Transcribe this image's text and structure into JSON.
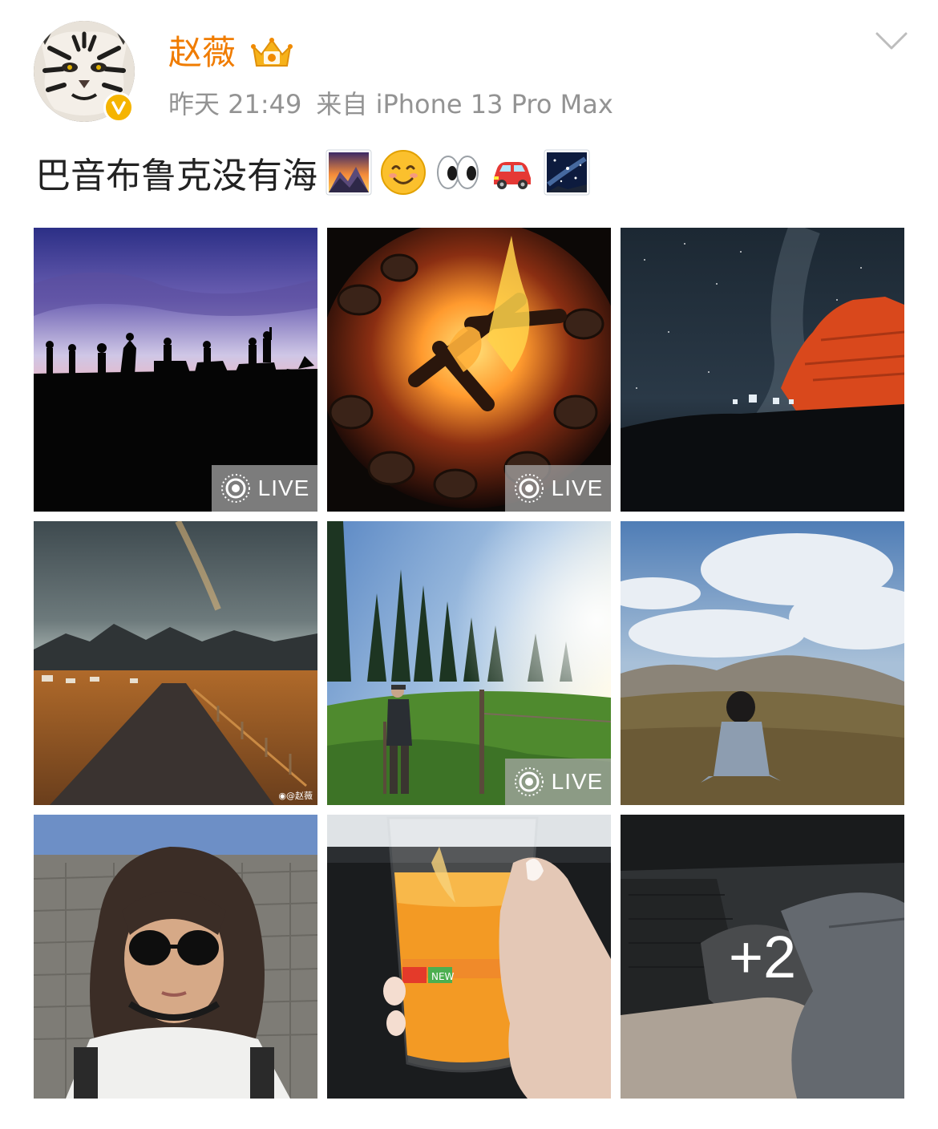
{
  "post": {
    "author": {
      "name": "赵薇",
      "avatar_icon": "tiger-face-avatar",
      "verified_icon": "verified-v-icon",
      "member_icon": "crown-icon"
    },
    "time": "昨天 21:49",
    "source": "来自 iPhone 13 Pro Max",
    "text": "巴音布鲁克没有海",
    "emojis": [
      "sunrise-over-mountains-emoji",
      "smiling-face-emoji",
      "eyes-emoji",
      "red-car-emoji",
      "milky-way-emoji"
    ],
    "menu_icon": "chevron-down-icon"
  },
  "photos": [
    {
      "id": "horse-riders-silhouette",
      "live": true,
      "live_label": "LIVE"
    },
    {
      "id": "campfire",
      "live": true,
      "live_label": "LIVE"
    },
    {
      "id": "milky-way-red-rock",
      "live": false
    },
    {
      "id": "road-rainbow-mountains",
      "live": false,
      "watermark": "◉@赵薇"
    },
    {
      "id": "man-in-forest-meadow",
      "live": true,
      "live_label": "LIVE"
    },
    {
      "id": "woman-on-grassland",
      "live": false
    },
    {
      "id": "selfie-sunglasses",
      "live": false
    },
    {
      "id": "juice-cup",
      "live": false,
      "cup_text": "NEW"
    },
    {
      "id": "car-interior-legs",
      "live": false,
      "more_count": "+2"
    }
  ],
  "colors": {
    "username": "#f07c00",
    "meta": "#939393",
    "verified": "#f5b400"
  }
}
